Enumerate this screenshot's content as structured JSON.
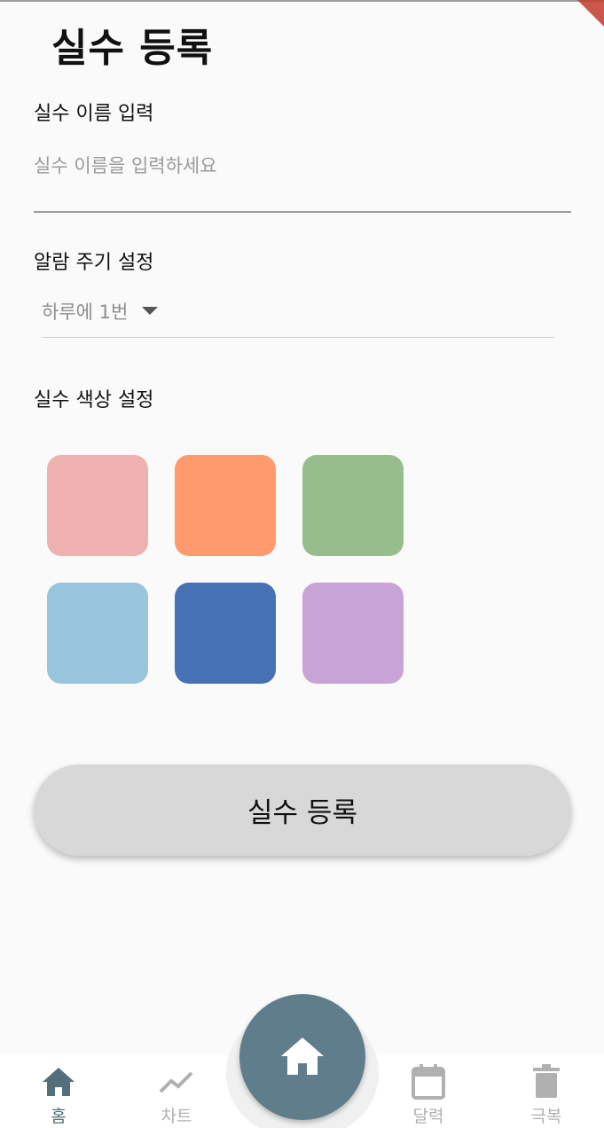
{
  "header": {
    "title": "실수 등록"
  },
  "form": {
    "name_label": "실수 이름 입력",
    "name_placeholder": "실수 이름을 입력하세요",
    "name_value": "",
    "alarm_label": "알람 주기 설정",
    "alarm_selected": "하루에 1번",
    "color_label": "실수 색상 설정",
    "colors": [
      "#efb0b0",
      "#ff9a6e",
      "#98bd8c",
      "#98c4dc",
      "#4672b4",
      "#c8a4d6"
    ],
    "submit_label": "실수 등록"
  },
  "bottom_nav": {
    "items": [
      {
        "label": "홈",
        "icon": "home-icon",
        "active": true
      },
      {
        "label": "차트",
        "icon": "chart-line-icon",
        "active": false
      },
      {
        "label": "달력",
        "icon": "calendar-icon",
        "active": false
      },
      {
        "label": "극복",
        "icon": "trash-icon",
        "active": false
      }
    ],
    "fab_icon": "home-icon",
    "active_color": "#546e7a",
    "inactive_color": "#b0b0b0",
    "fab_color": "#607d8b"
  }
}
